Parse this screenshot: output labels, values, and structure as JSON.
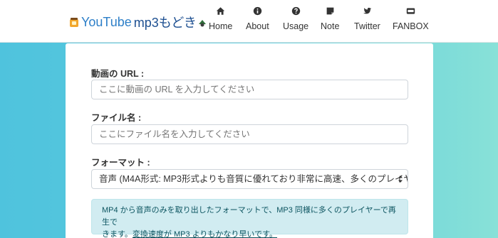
{
  "brand": {
    "title_a": "YouTube",
    "title_b": "mp3もどき"
  },
  "nav": [
    {
      "label": "Home",
      "icon": "home-icon"
    },
    {
      "label": "About",
      "icon": "info-circle-icon"
    },
    {
      "label": "Usage",
      "icon": "question-circle-icon"
    },
    {
      "label": "Note",
      "icon": "note-icon"
    },
    {
      "label": "Twitter",
      "icon": "twitter-icon"
    },
    {
      "label": "FANBOX",
      "icon": "fanbox-icon"
    }
  ],
  "form": {
    "url_label": "動画の URL :",
    "url_placeholder": "ここに動画の URL を入力してください",
    "filename_label": "ファイル名 :",
    "filename_placeholder": "ここにファイル名を入力してください",
    "format_label": "フォーマット :",
    "format_selected": "音声 (M4A形式: MP3形式よりも音質に優れており非常に高速、多くのプレイヤ"
  },
  "info": {
    "text_1": "MP4 から音声のみを取り出したフォーマットで、MP3 同様に多くのプレイヤーで再生で",
    "text_2": "きます。",
    "link_text": "変換速度が MP3 よりもかなり早いです。"
  },
  "colors": {
    "brand_primary": "#2d7fc8",
    "brand_secondary": "#1d4f91",
    "alert_bg": "#d1ecf1",
    "alert_text": "#0c5460",
    "bg_gradient_start": "#4fc3dd",
    "bg_gradient_end": "#88e1d8"
  }
}
